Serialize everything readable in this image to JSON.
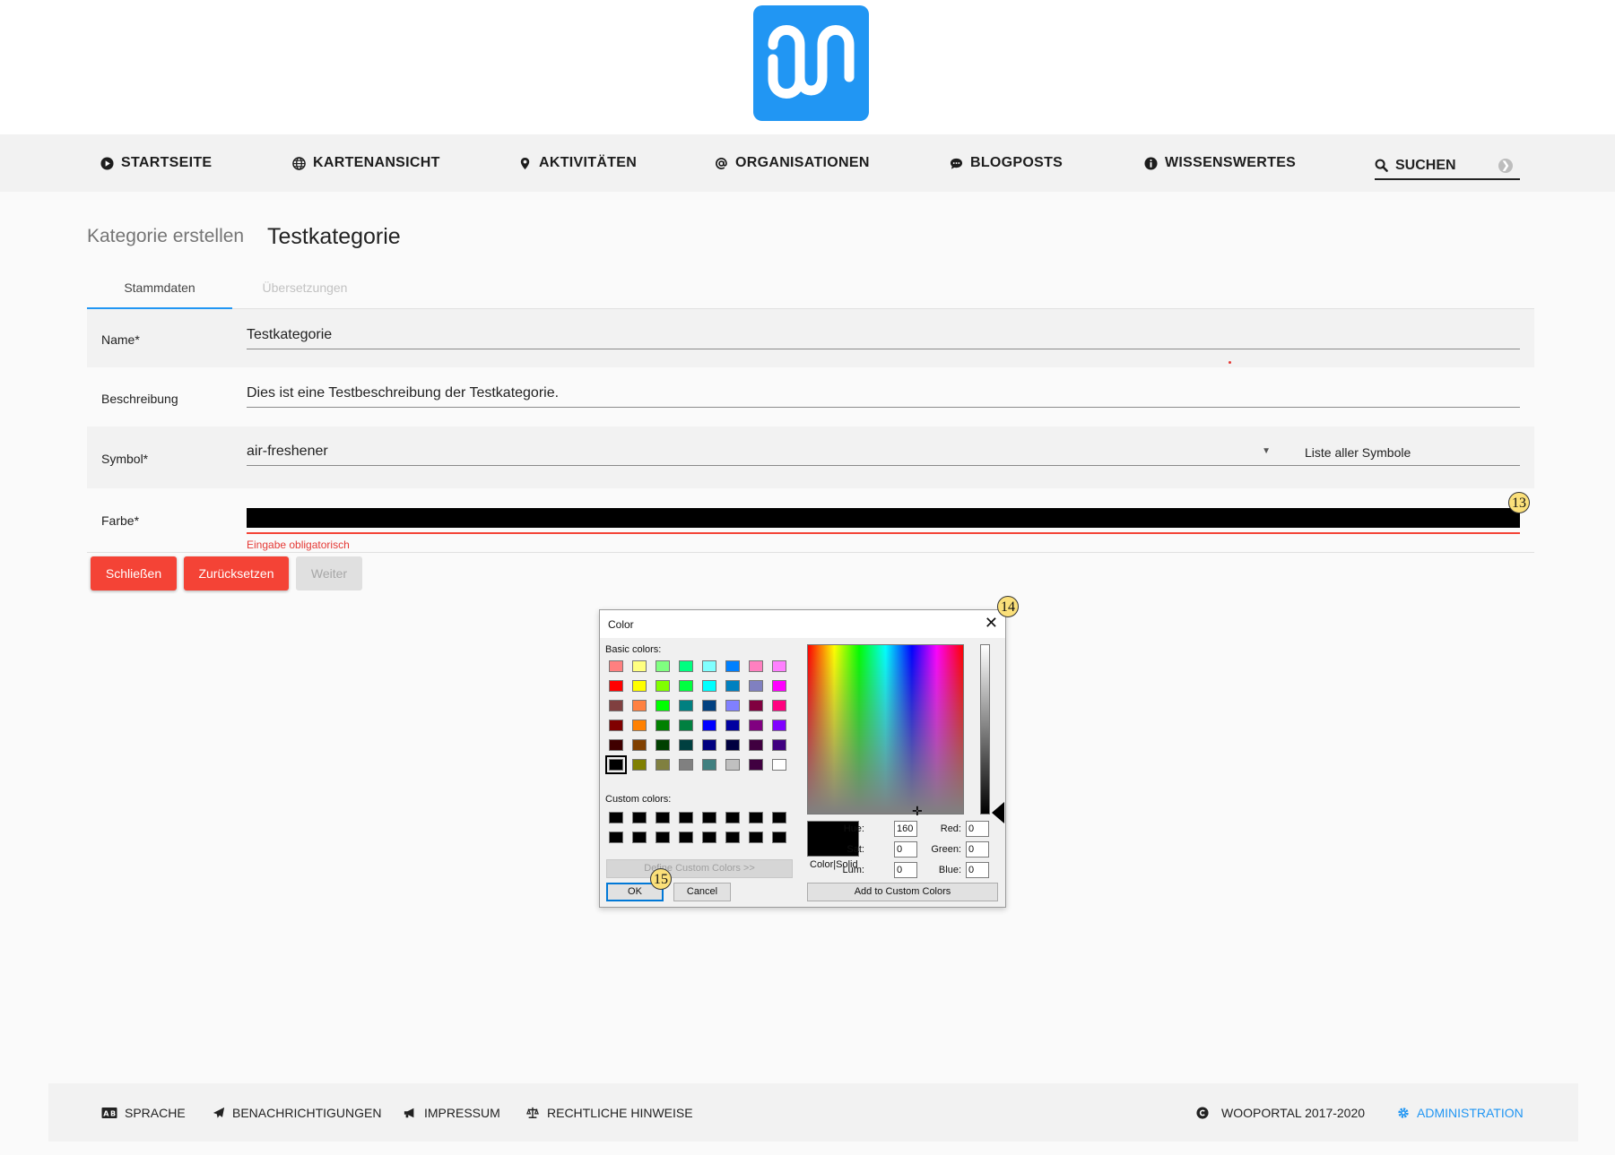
{
  "colors": {
    "accent": "#2196f3",
    "danger": "#f44336",
    "selected_color": "#000000"
  },
  "nav": {
    "items": [
      {
        "label": "STARTSEITE",
        "icon": "play-circle-icon"
      },
      {
        "label": "KARTENANSICHT",
        "icon": "globe-icon"
      },
      {
        "label": "AKTIVITÄTEN",
        "icon": "map-marker-icon"
      },
      {
        "label": "ORGANISATIONEN",
        "icon": "at-sign-icon"
      },
      {
        "label": "BLOGPOSTS",
        "icon": "chat-bubble-icon"
      },
      {
        "label": "WISSENSWERTES",
        "icon": "info-icon"
      }
    ],
    "search_label": "SUCHEN"
  },
  "page": {
    "breadcrumb": "Kategorie erstellen",
    "title": "Testkategorie"
  },
  "tabs": [
    "Stammdaten",
    "Übersetzungen"
  ],
  "form": {
    "name": {
      "label": "Name*",
      "value": "Testkategorie"
    },
    "description": {
      "label": "Beschreibung",
      "value": "Dies ist eine Testbeschreibung der Testkategorie."
    },
    "symbol": {
      "label": "Symbol*",
      "value": "air-freshener",
      "link": "Liste aller Symbole"
    },
    "color": {
      "label": "Farbe*",
      "error": "Eingabe obligatorisch"
    }
  },
  "buttons": {
    "close": "Schließen",
    "reset": "Zurücksetzen",
    "next": "Weiter"
  },
  "annotations": [
    "13",
    "14",
    "15"
  ],
  "color_dialog": {
    "title": "Color",
    "basic_colors_label": "Basic colors:",
    "custom_colors_label": "Custom colors:",
    "define_custom": "Define Custom Colors >>",
    "ok": "OK",
    "cancel": "Cancel",
    "color_solid": "Color|Solid",
    "add_custom": "Add to Custom Colors",
    "fields": {
      "hue": {
        "label": "Hue:",
        "value": "160"
      },
      "sat": {
        "label": "Sat:",
        "value": "0"
      },
      "lum": {
        "label": "Lum:",
        "value": "0"
      },
      "red": {
        "label": "Red:",
        "value": "0"
      },
      "green": {
        "label": "Green:",
        "value": "0"
      },
      "blue": {
        "label": "Blue:",
        "value": "0"
      }
    },
    "basic_colors": [
      "#ff8080",
      "#ffff80",
      "#80ff80",
      "#00ff80",
      "#80ffff",
      "#0080ff",
      "#ff80c0",
      "#ff80ff",
      "#ff0000",
      "#ffff00",
      "#80ff00",
      "#00ff40",
      "#00ffff",
      "#0080c0",
      "#8080c0",
      "#ff00ff",
      "#804040",
      "#ff8040",
      "#00ff00",
      "#008080",
      "#004080",
      "#8080ff",
      "#800040",
      "#ff0080",
      "#800000",
      "#ff8000",
      "#008000",
      "#008040",
      "#0000ff",
      "#0000a0",
      "#800080",
      "#8000ff",
      "#400000",
      "#804000",
      "#004000",
      "#004040",
      "#000080",
      "#000040",
      "#400040",
      "#400080",
      "#000000",
      "#808000",
      "#808040",
      "#808080",
      "#408080",
      "#c0c0c0",
      "#400040",
      "#ffffff"
    ]
  },
  "footer": {
    "language": "SPRACHE",
    "notifications": "BENACHRICHTIGUNGEN",
    "imprint": "IMPRESSUM",
    "legal": "RECHTLICHE HINWEISE",
    "copyright": "WOOPORTAL 2017-2020",
    "admin": "ADMINISTRATION"
  }
}
